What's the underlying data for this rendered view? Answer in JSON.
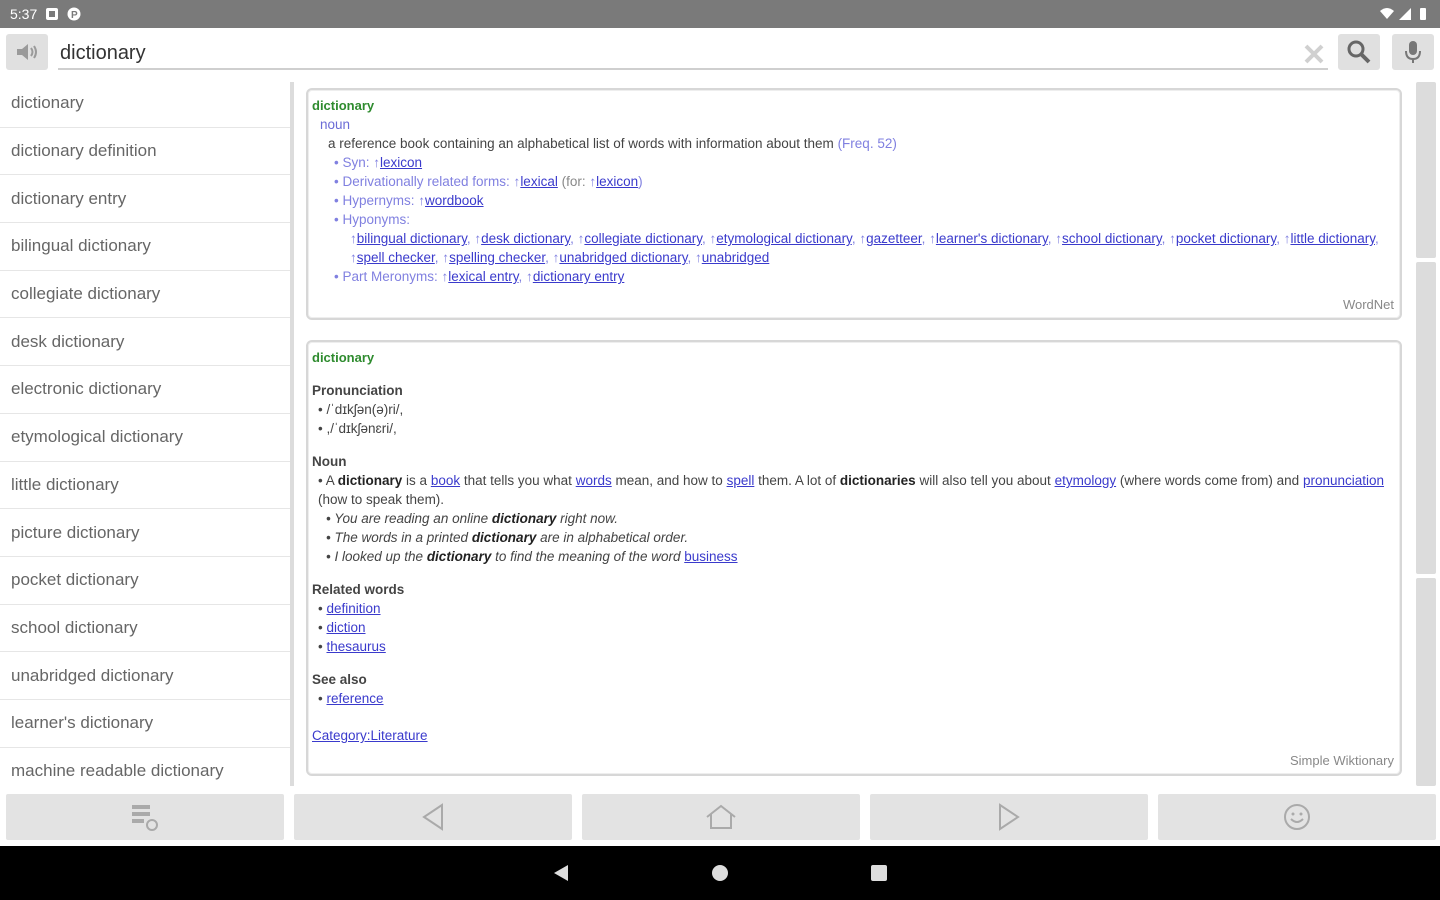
{
  "status_bar": {
    "time": "5:37"
  },
  "search": {
    "value": "dictionary"
  },
  "sidebar": {
    "items": [
      "dictionary",
      "dictionary definition",
      "dictionary entry",
      "bilingual dictionary",
      "collegiate dictionary",
      "desk dictionary",
      "electronic dictionary",
      "etymological dictionary",
      "little dictionary",
      "picture dictionary",
      "pocket dictionary",
      "school dictionary",
      "unabridged dictionary",
      "learner's dictionary",
      "machine readable dictionary"
    ]
  },
  "wordnet": {
    "headword": "dictionary",
    "pos": "noun",
    "definition": "a reference book containing an alphabetical list of words with information about them",
    "freq": "(Freq. 52)",
    "syn_label": "• Syn:",
    "syn": "lexicon",
    "deriv_label": "• Derivationally related forms:",
    "deriv": "lexical",
    "deriv_for": "(for:",
    "deriv_for_link": "lexicon",
    "deriv_close": ")",
    "hyper_label": "• Hypernyms:",
    "hyper": "wordbook",
    "hypo_label": "• Hyponyms:",
    "hyponyms": [
      "bilingual dictionary",
      "desk dictionary",
      "collegiate dictionary",
      "etymological dictionary",
      "gazetteer",
      "learner's dictionary",
      "school dictionary",
      "pocket dictionary",
      "little dictionary",
      "spell checker",
      "spelling checker",
      "unabridged dictionary",
      "unabridged"
    ],
    "mero_label": "• Part Meronyms:",
    "meronyms": [
      "lexical entry",
      "dictionary entry"
    ],
    "source": "WordNet"
  },
  "wiktionary": {
    "headword": "dictionary",
    "pron_heading": "Pronunciation",
    "pron": [
      "• /ˈdɪkʃən(ə)ri/,",
      "• ,/ˈdɪkʃənɛri/,"
    ],
    "noun_heading": "Noun",
    "noun_def": {
      "bullet": "• A",
      "w1": "dictionary",
      "t1": "is a",
      "l1": "book",
      "t2": "that tells you what",
      "l2": "words",
      "t3": "mean, and how to",
      "l3": "spell",
      "t4": "them. A lot of",
      "w2": "dictionaries",
      "t5": "will also tell you about",
      "l4": "etymology",
      "t6": "(where words come from) and",
      "l5": "pronunciation",
      "t7": "(how to speak them)."
    },
    "ex1": {
      "a": "• You are reading an online",
      "b": "dictionary",
      "c": "right now."
    },
    "ex2": {
      "a": "• The words in a printed",
      "b": "dictionary",
      "c": "are in alphabetical order."
    },
    "ex3": {
      "a": "• I looked up the",
      "b": "dictionary",
      "c": "to find the meaning of the word",
      "d": "business"
    },
    "related_heading": "Related words",
    "related": [
      "definition",
      "diction",
      "thesaurus"
    ],
    "see_heading": "See also",
    "see": [
      "reference"
    ],
    "category": "Category:Literature",
    "source": "Simple Wiktionary"
  }
}
